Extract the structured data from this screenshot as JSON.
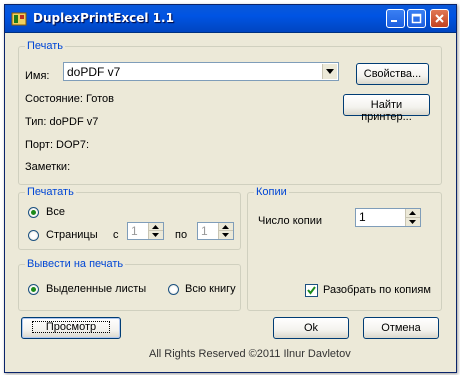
{
  "window": {
    "title": "DuplexPrintExcel 1.1",
    "icon": "excel-print-icon",
    "controls": [
      "minimize-icon",
      "maximize-icon",
      "close-icon"
    ]
  },
  "printer_group": {
    "legend": "Печать",
    "name_label": "Имя:",
    "name_value": "doPDF v7",
    "properties_button": "Свойства...",
    "find_button": "Найти принтер...",
    "status_line": "Состояние: Готов",
    "type_line": "Тип: doPDF v7",
    "port_line": "Порт: DOP7:",
    "notes_line": "Заметки:"
  },
  "print_range": {
    "legend": "Печатать",
    "all_label": "Все",
    "pages_label": "Страницы",
    "from_label": "с",
    "from_value": "1",
    "to_label": "по",
    "to_value": "1",
    "selected": "all"
  },
  "output": {
    "legend": "Вывести на печать",
    "selected_sheets_label": "Выделенные листы",
    "whole_book_label": "Всю книгу",
    "selected": "selected_sheets"
  },
  "copies": {
    "legend": "Копии",
    "count_label": "Число копии",
    "count_value": "1",
    "collate_label": "Разобрать по копиям",
    "collate_checked": true
  },
  "footer": {
    "preview_button": "Просмотр",
    "ok_button": "Ok",
    "cancel_button": "Отмена",
    "copyright": "All Rights Reserved ©2011 Ilnur Davletov"
  },
  "colors": {
    "title_bar": "#0054e3",
    "dialog_bg": "#ece9d8",
    "group_legend": "#0046d5"
  }
}
